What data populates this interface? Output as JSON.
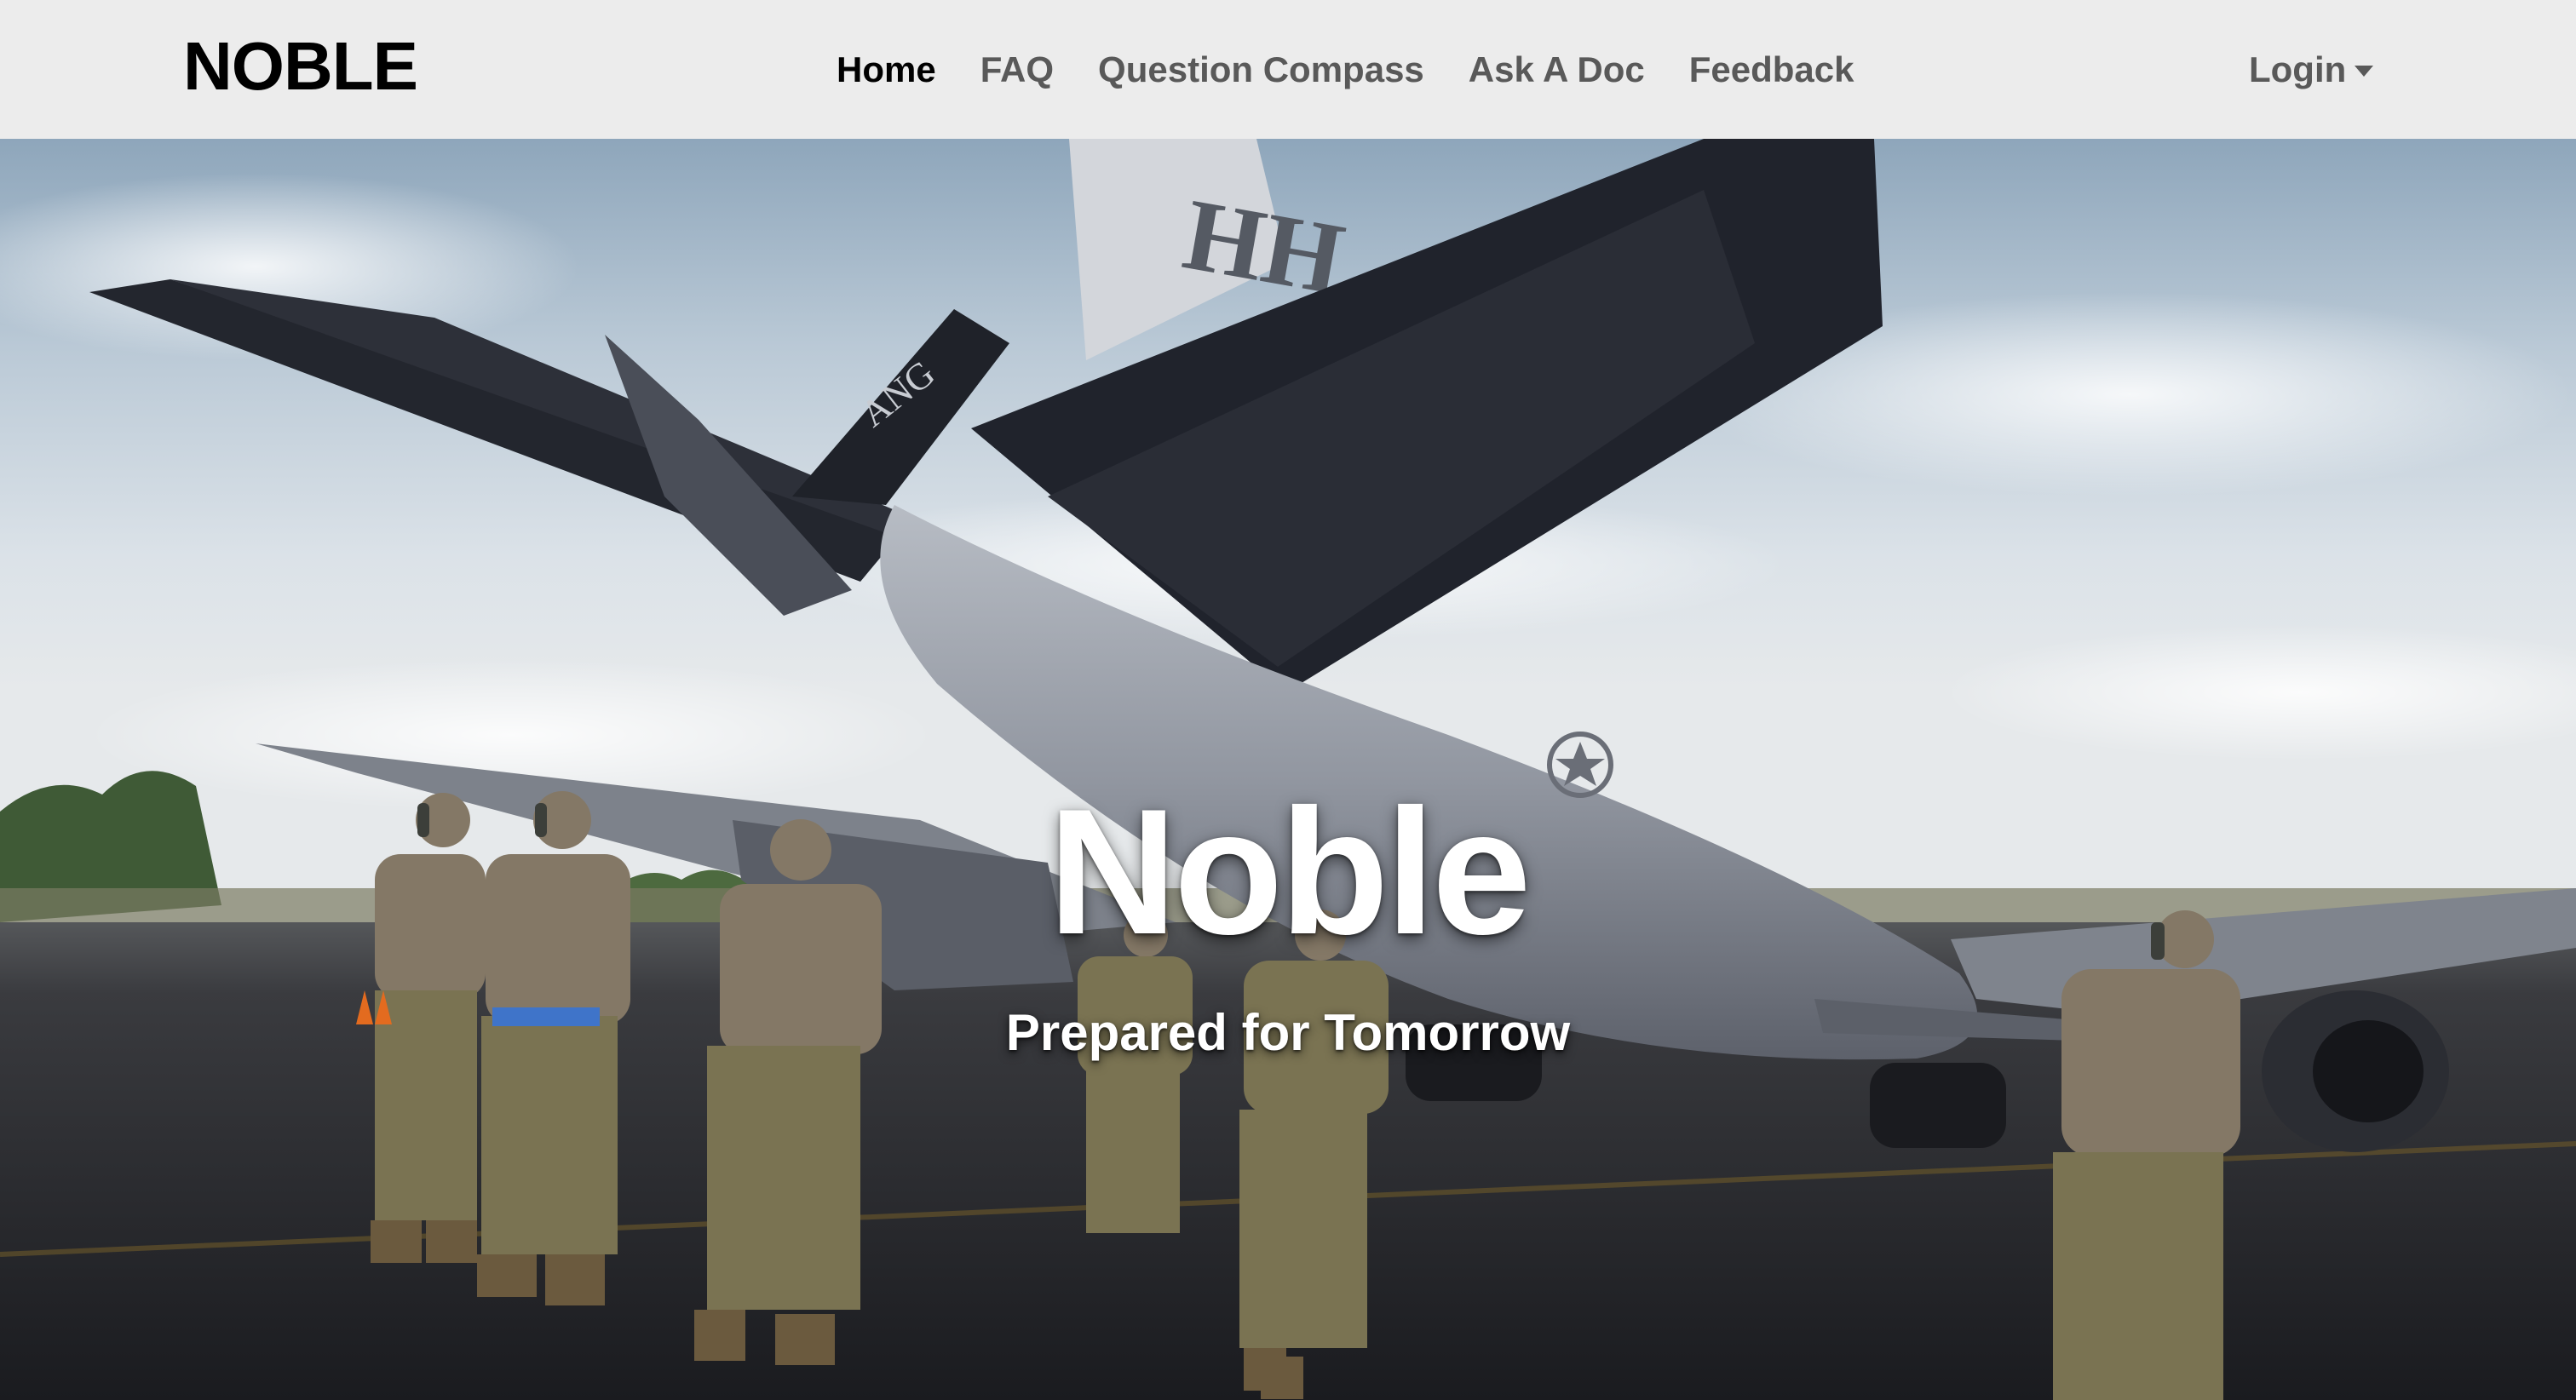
{
  "navbar": {
    "brand": "NOBLE",
    "links": [
      {
        "label": "Home",
        "active": true
      },
      {
        "label": "FAQ",
        "active": false
      },
      {
        "label": "Question Compass",
        "active": false
      },
      {
        "label": "Ask A Doc",
        "active": false
      },
      {
        "label": "Feedback",
        "active": false
      }
    ],
    "login_label": "Login"
  },
  "hero": {
    "title": "Noble",
    "subtitle": "Prepared for Tomorrow",
    "image_tail_marking": "HH",
    "image_boom_marking": "ANG"
  },
  "colors": {
    "navbar_bg": "#ececec",
    "nav_active": "#000000",
    "nav_inactive": "#595959",
    "hero_text": "#ffffff"
  },
  "icons": {
    "login_caret": "caret-down-icon"
  }
}
